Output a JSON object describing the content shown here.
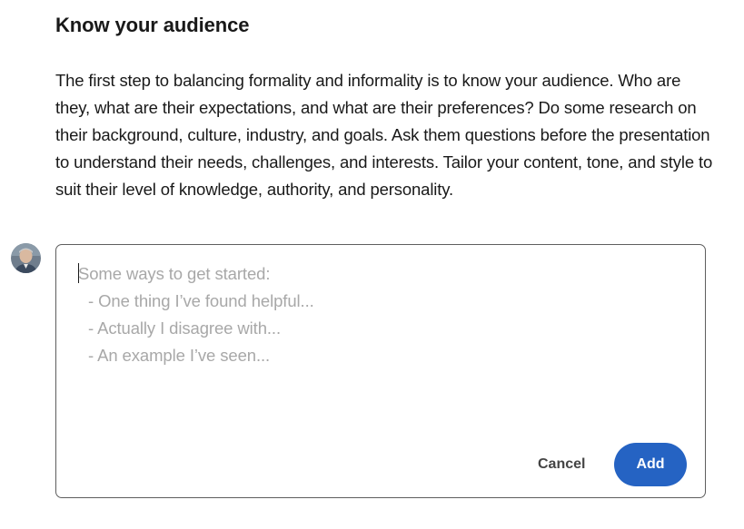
{
  "section": {
    "title": "Know your audience",
    "body": "The first step to balancing formality and informality is to know your audience. Who are they, what are their expectations, and what are their preferences? Do some research on their background, culture, industry, and goals. Ask them questions before the presentation to understand their needs, challenges, and interests. Tailor your content, tone, and style to suit their level of knowledge, authority, and personality."
  },
  "comment": {
    "avatar_icon": "user-avatar-icon",
    "value": "",
    "placeholder_lines": [
      "Some ways to get started:",
      "- One thing I’ve found helpful...",
      "- Actually I disagree with...",
      "- An example I’ve seen..."
    ],
    "cancel_label": "Cancel",
    "add_label": "Add"
  },
  "colors": {
    "accent": "#2563c3",
    "text": "#191919",
    "placeholder": "#a8a8a8",
    "border": "#5e5e5e"
  }
}
